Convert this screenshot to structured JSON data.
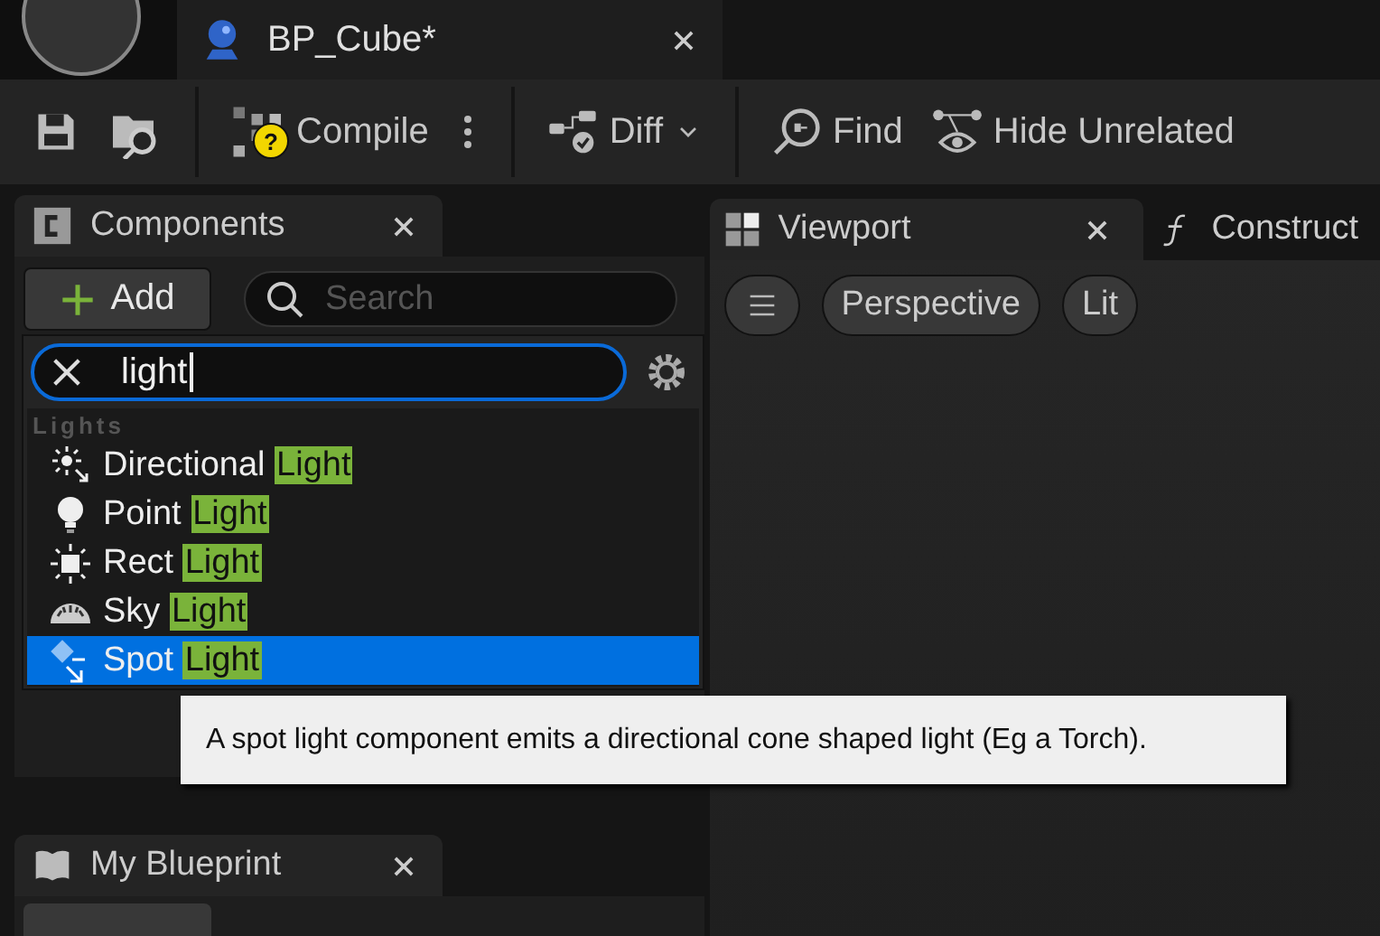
{
  "asset_tab": {
    "title": "BP_Cube*"
  },
  "toolbar": [
    {
      "kind": "save"
    },
    {
      "kind": "browse"
    },
    {
      "kind": "compile",
      "label": "Compile",
      "badge": "?"
    },
    {
      "kind": "more"
    },
    {
      "kind": "diff",
      "label": "Diff"
    },
    {
      "kind": "find",
      "label": "Find"
    },
    {
      "kind": "hide",
      "label": "Hide Unrelated"
    }
  ],
  "components_panel": {
    "tab": "Components",
    "add_label": "Add",
    "search_placeholder": "Search"
  },
  "add_menu": {
    "query": "light",
    "category": "Lights",
    "items": [
      {
        "prefix": "Directional",
        "match": "Light",
        "kind": "directional",
        "selected": false
      },
      {
        "prefix": "Point",
        "match": "Light",
        "kind": "point",
        "selected": false
      },
      {
        "prefix": "Rect",
        "match": "Light",
        "kind": "rect",
        "selected": false
      },
      {
        "prefix": "Sky",
        "match": "Light",
        "kind": "sky",
        "selected": false
      },
      {
        "prefix": "Spot",
        "match": "Light",
        "kind": "spot",
        "selected": true
      }
    ]
  },
  "tooltip": "A spot light component emits a directional cone shaped light (Eg a Torch).",
  "blueprint_panel": {
    "tab": "My Blueprint"
  },
  "viewport_tabs": [
    {
      "label": "Viewport",
      "kind": "viewport",
      "selected": true
    },
    {
      "label": "Construct",
      "kind": "function",
      "selected": false
    }
  ],
  "viewport_toolbar": [
    "Perspective",
    "Lit"
  ]
}
